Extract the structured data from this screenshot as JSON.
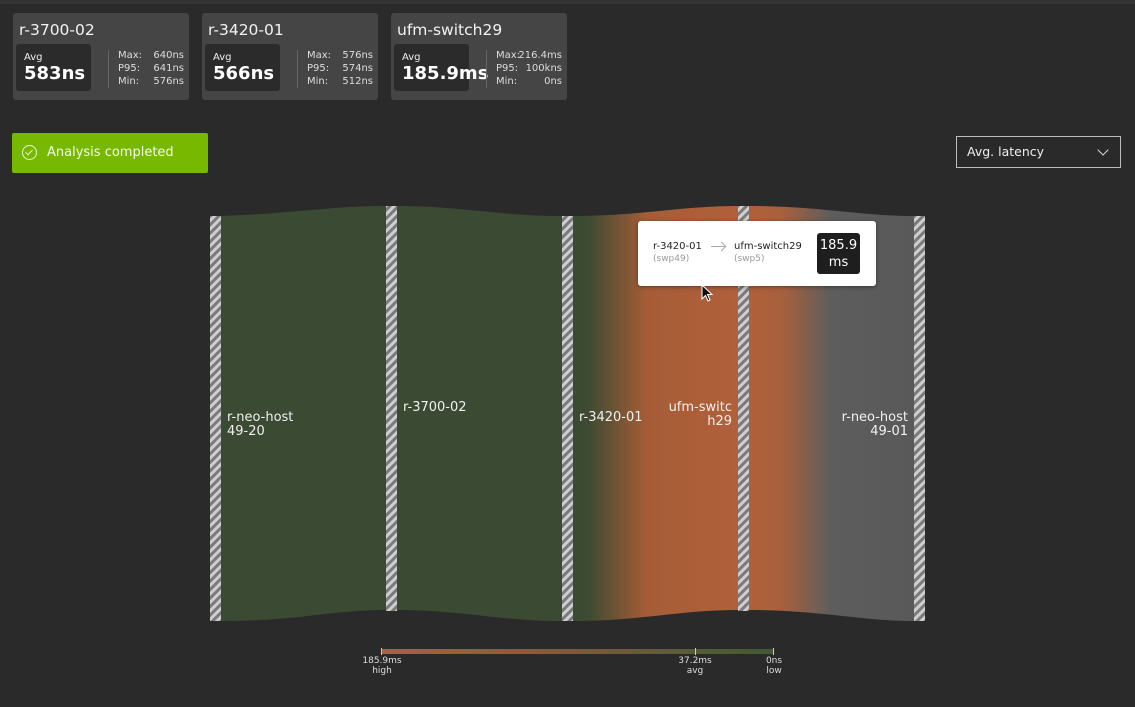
{
  "cards": [
    {
      "title": "r-3700-02",
      "avg_label": "Avg",
      "avg": "583ns",
      "stats": [
        {
          "k": "Max:",
          "v": "640ns"
        },
        {
          "k": "P95:",
          "v": "641ns"
        },
        {
          "k": "Min:",
          "v": "576ns"
        }
      ]
    },
    {
      "title": "r-3420-01",
      "avg_label": "Avg",
      "avg": "566ns",
      "stats": [
        {
          "k": "Max:",
          "v": "576ns"
        },
        {
          "k": "P95:",
          "v": "574ns"
        },
        {
          "k": "Min:",
          "v": "512ns"
        }
      ]
    },
    {
      "title": "ufm-switch29",
      "avg_label": "Avg",
      "avg": "185.9ms",
      "stats": [
        {
          "k": "Max:",
          "v": "216.4ms"
        },
        {
          "k": "P95:",
          "v": "100kns"
        },
        {
          "k": "Min:",
          "v": "0ns"
        }
      ]
    }
  ],
  "status": {
    "text": "Analysis completed",
    "color": "#76b900",
    "icon": "check-circle-icon"
  },
  "metric_select": {
    "value": "Avg. latency",
    "icon": "chevron-down-icon"
  },
  "nodes": [
    {
      "line1": "r-neo-host",
      "line2": "49-20"
    },
    {
      "line1": "r-3700-02",
      "line2": ""
    },
    {
      "line1": "r-3420-01",
      "line2": ""
    },
    {
      "line1": "ufm-switc",
      "line2": "h29"
    },
    {
      "line1": "r-neo-host",
      "line2": "49-01"
    }
  ],
  "link_colors": {
    "low": "#3a4a33",
    "high": "#b0603a",
    "neutral": "#595959"
  },
  "tooltip": {
    "source": "r-3420-01",
    "source_port": "(swp49)",
    "target": "ufm-switch29",
    "target_port": "(swp5)",
    "value_line1": "185.9",
    "value_line2": "ms"
  },
  "legend": {
    "high_value": "185.9ms",
    "high_label": "high",
    "avg_value": "37.2ms",
    "avg_label": "avg",
    "low_value": "0ns",
    "low_label": "low"
  }
}
